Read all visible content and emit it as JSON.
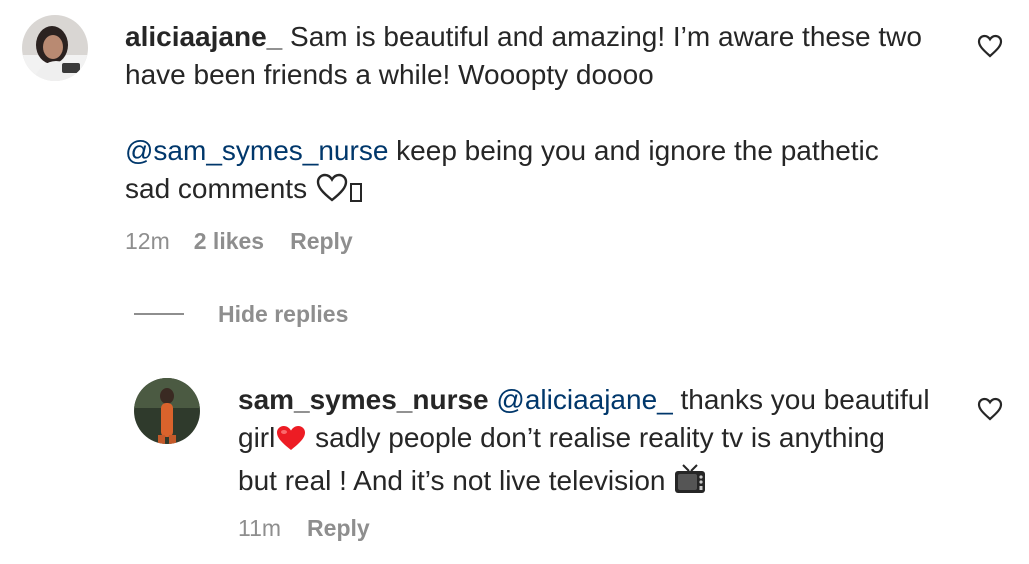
{
  "comments": [
    {
      "username": "aliciaajane_",
      "text_line1": " Sam is beautiful and amazing! I’m aware these two",
      "text_line2": "have been friends a while! Wooopty doooo",
      "mention": "@sam_symes_nurse",
      "text_line3": " keep being you and ignore the pathetic",
      "text_line4": "sad comments ",
      "time": "12m",
      "likes": "2 likes",
      "reply_label": "Reply",
      "like_icon": "heart-outline-icon"
    }
  ],
  "hide_replies_label": "Hide replies",
  "replies": [
    {
      "username": "sam_symes_nurse",
      "mention": "@aliciaajane_",
      "text_line1": " thanks you beautiful",
      "text_line2a": "girl",
      "text_line2b": " sadly people don’t realise reality tv is anything",
      "text_line3": "but real ! And it’s not live television ",
      "time": "11m",
      "reply_label": "Reply",
      "like_icon": "heart-outline-icon"
    }
  ],
  "colors": {
    "text": "#262626",
    "secondary": "#8e8e8e",
    "mention": "#00376b",
    "heart_red": "#ed1c24"
  }
}
